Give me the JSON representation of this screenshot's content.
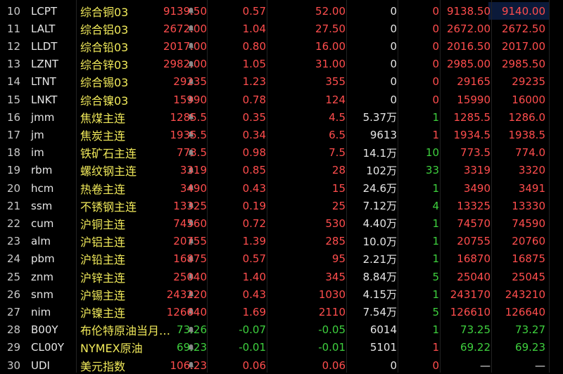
{
  "colors": {
    "up": "#ff4d4d",
    "down": "#3ed03e",
    "neutral": "#e6e6e6",
    "name": "#f0e95a",
    "background": "#000000"
  },
  "rows": [
    {
      "idx": "10",
      "code": "LCPT",
      "name": "综合铜03",
      "price": "9139.50",
      "chg_pct": "0.57",
      "chg": "52.00",
      "vol": "0",
      "cur": "0",
      "bid": "9138.50",
      "ask": "9140.00",
      "price_dir": "up",
      "chg_dir": "up",
      "cur_dir": "up",
      "bid_dir": "up",
      "ask_dir": "up",
      "ask_selected": true
    },
    {
      "idx": "11",
      "code": "LALT",
      "name": "综合铝03",
      "price": "2672.00",
      "chg_pct": "1.04",
      "chg": "27.50",
      "vol": "0",
      "cur": "0",
      "bid": "2672.00",
      "ask": "2672.50",
      "price_dir": "up",
      "chg_dir": "up",
      "cur_dir": "up",
      "bid_dir": "up",
      "ask_dir": "up"
    },
    {
      "idx": "12",
      "code": "LLDT",
      "name": "综合铅03",
      "price": "2017.00",
      "chg_pct": "0.80",
      "chg": "16.00",
      "vol": "0",
      "cur": "0",
      "bid": "2016.50",
      "ask": "2017.00",
      "price_dir": "up",
      "chg_dir": "up",
      "cur_dir": "up",
      "bid_dir": "up",
      "ask_dir": "up"
    },
    {
      "idx": "13",
      "code": "LZNT",
      "name": "综合锌03",
      "price": "2982.00",
      "chg_pct": "1.05",
      "chg": "31.00",
      "vol": "0",
      "cur": "0",
      "bid": "2985.00",
      "ask": "2985.50",
      "price_dir": "up",
      "chg_dir": "up",
      "cur_dir": "up",
      "bid_dir": "up",
      "ask_dir": "up"
    },
    {
      "idx": "14",
      "code": "LTNT",
      "name": "综合锡03",
      "price": "29235",
      "chg_pct": "1.23",
      "chg": "355",
      "vol": "0",
      "cur": "0",
      "bid": "29165",
      "ask": "29235",
      "price_dir": "up",
      "chg_dir": "up",
      "cur_dir": "up",
      "bid_dir": "up",
      "ask_dir": "up"
    },
    {
      "idx": "15",
      "code": "LNKT",
      "name": "综合镍03",
      "price": "15990",
      "chg_pct": "0.78",
      "chg": "124",
      "vol": "0",
      "cur": "0",
      "bid": "15990",
      "ask": "16000",
      "price_dir": "up",
      "chg_dir": "up",
      "cur_dir": "up",
      "bid_dir": "up",
      "ask_dir": "up"
    },
    {
      "idx": "16",
      "code": "jmm",
      "name": "焦煤主连",
      "price": "1285.5",
      "chg_pct": "0.35",
      "chg": "4.5",
      "vol": "5.37万",
      "cur": "1",
      "bid": "1285.5",
      "ask": "1286.0",
      "price_dir": "up",
      "chg_dir": "up",
      "cur_dir": "down",
      "bid_dir": "up",
      "ask_dir": "up"
    },
    {
      "idx": "17",
      "code": "jm",
      "name": "焦炭主连",
      "price": "1935.5",
      "chg_pct": "0.34",
      "chg": "6.5",
      "vol": "9613",
      "cur": "1",
      "bid": "1934.5",
      "ask": "1938.5",
      "price_dir": "up",
      "chg_dir": "up",
      "cur_dir": "up",
      "bid_dir": "up",
      "ask_dir": "up"
    },
    {
      "idx": "18",
      "code": "im",
      "name": "铁矿石主连",
      "price": "773.5",
      "chg_pct": "0.98",
      "chg": "7.5",
      "vol": "14.1万",
      "cur": "10",
      "bid": "773.5",
      "ask": "774.0",
      "price_dir": "up",
      "chg_dir": "up",
      "cur_dir": "down",
      "bid_dir": "up",
      "ask_dir": "up"
    },
    {
      "idx": "19",
      "code": "rbm",
      "name": "螺纹钢主连",
      "price": "3319",
      "chg_pct": "0.85",
      "chg": "28",
      "vol": "102万",
      "cur": "33",
      "bid": "3319",
      "ask": "3320",
      "price_dir": "up",
      "chg_dir": "up",
      "cur_dir": "down",
      "bid_dir": "up",
      "ask_dir": "up"
    },
    {
      "idx": "20",
      "code": "hcm",
      "name": "热卷主连",
      "price": "3490",
      "chg_pct": "0.43",
      "chg": "15",
      "vol": "24.6万",
      "cur": "1",
      "bid": "3490",
      "ask": "3491",
      "price_dir": "up",
      "chg_dir": "up",
      "cur_dir": "down",
      "bid_dir": "up",
      "ask_dir": "up"
    },
    {
      "idx": "21",
      "code": "ssm",
      "name": "不锈钢主连",
      "price": "13325",
      "chg_pct": "0.19",
      "chg": "25",
      "vol": "7.12万",
      "cur": "4",
      "bid": "13325",
      "ask": "13330",
      "price_dir": "up",
      "chg_dir": "up",
      "cur_dir": "down",
      "bid_dir": "up",
      "ask_dir": "up"
    },
    {
      "idx": "22",
      "code": "cum",
      "name": "沪铜主连",
      "price": "74560",
      "chg_pct": "0.72",
      "chg": "530",
      "vol": "4.40万",
      "cur": "1",
      "bid": "74570",
      "ask": "74590",
      "price_dir": "up",
      "chg_dir": "up",
      "cur_dir": "down",
      "bid_dir": "up",
      "ask_dir": "up"
    },
    {
      "idx": "23",
      "code": "alm",
      "name": "沪铝主连",
      "price": "20755",
      "chg_pct": "1.39",
      "chg": "285",
      "vol": "10.0万",
      "cur": "1",
      "bid": "20755",
      "ask": "20760",
      "price_dir": "up",
      "chg_dir": "up",
      "cur_dir": "down",
      "bid_dir": "up",
      "ask_dir": "up"
    },
    {
      "idx": "24",
      "code": "pbm",
      "name": "沪铅主连",
      "price": "16875",
      "chg_pct": "0.57",
      "chg": "95",
      "vol": "2.21万",
      "cur": "1",
      "bid": "16870",
      "ask": "16875",
      "price_dir": "up",
      "chg_dir": "up",
      "cur_dir": "down",
      "bid_dir": "up",
      "ask_dir": "up"
    },
    {
      "idx": "25",
      "code": "znm",
      "name": "沪锌主连",
      "price": "25040",
      "chg_pct": "1.40",
      "chg": "345",
      "vol": "8.84万",
      "cur": "5",
      "bid": "25040",
      "ask": "25045",
      "price_dir": "up",
      "chg_dir": "up",
      "cur_dir": "down",
      "bid_dir": "up",
      "ask_dir": "up"
    },
    {
      "idx": "26",
      "code": "snm",
      "name": "沪锡主连",
      "price": "243220",
      "chg_pct": "0.43",
      "chg": "1030",
      "vol": "4.15万",
      "cur": "1",
      "bid": "243170",
      "ask": "243210",
      "price_dir": "up",
      "chg_dir": "up",
      "cur_dir": "down",
      "bid_dir": "up",
      "ask_dir": "up"
    },
    {
      "idx": "27",
      "code": "nim",
      "name": "沪镍主连",
      "price": "126640",
      "chg_pct": "1.69",
      "chg": "2110",
      "vol": "7.54万",
      "cur": "5",
      "bid": "126610",
      "ask": "126640",
      "price_dir": "up",
      "chg_dir": "up",
      "cur_dir": "down",
      "bid_dir": "up",
      "ask_dir": "up"
    },
    {
      "idx": "28",
      "code": "B00Y",
      "name": "布伦特原油当月…",
      "price": "73.26",
      "chg_pct": "-0.07",
      "chg": "-0.05",
      "vol": "6014",
      "cur": "1",
      "bid": "73.25",
      "ask": "73.27",
      "price_dir": "down",
      "chg_dir": "down",
      "cur_dir": "down",
      "bid_dir": "down",
      "ask_dir": "down"
    },
    {
      "idx": "29",
      "code": "CL00Y",
      "name": "NYMEX原油",
      "price": "69.23",
      "chg_pct": "-0.01",
      "chg": "-0.01",
      "vol": "5101",
      "cur": "1",
      "bid": "69.22",
      "ask": "69.23",
      "price_dir": "down",
      "chg_dir": "down",
      "cur_dir": "up",
      "bid_dir": "down",
      "ask_dir": "down"
    },
    {
      "idx": "30",
      "code": "UDI",
      "name": "美元指数",
      "price": "106.23",
      "chg_pct": "0.06",
      "chg": "0.06",
      "vol": "0",
      "cur": "0",
      "bid": "—",
      "ask": "—",
      "price_dir": "up",
      "chg_dir": "up",
      "cur_dir": "up",
      "bid_dir": "neutral",
      "ask_dir": "neutral"
    }
  ]
}
